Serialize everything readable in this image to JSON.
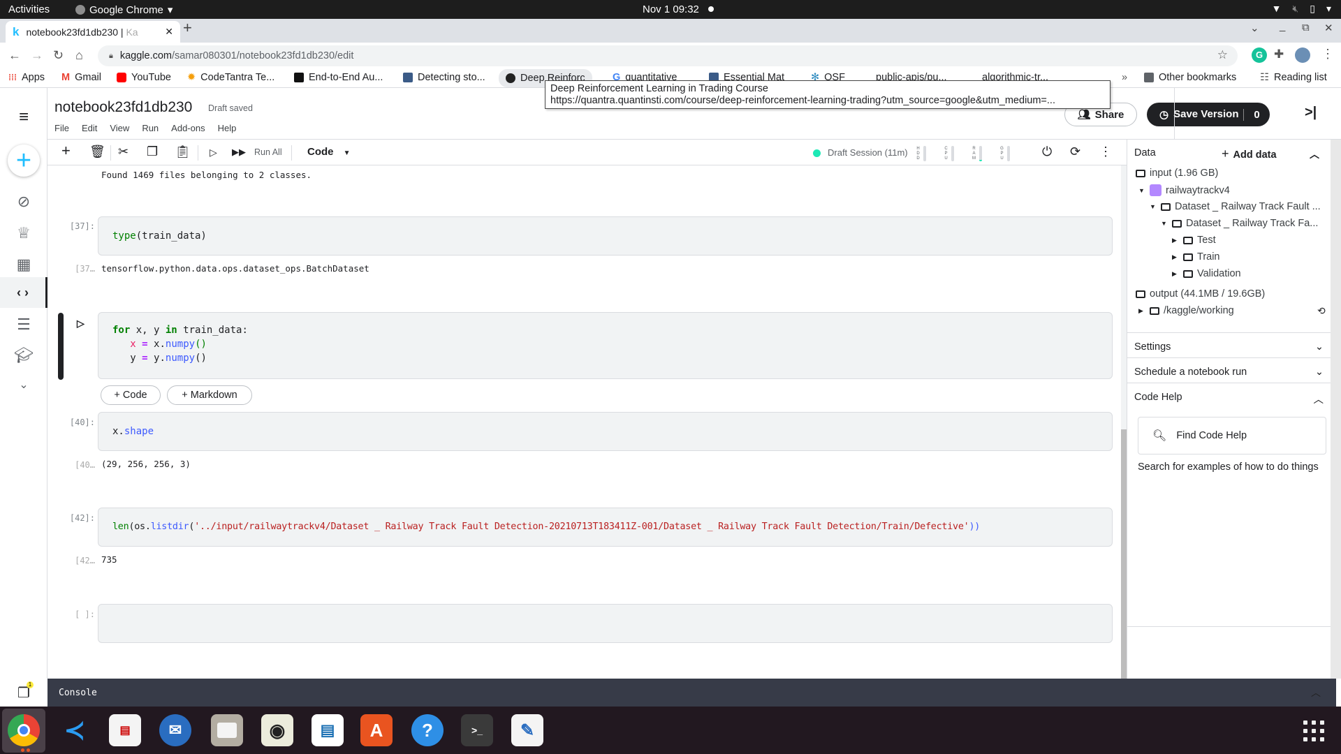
{
  "system": {
    "activities": "Activities",
    "app_name": "Google Chrome",
    "clock": "Nov 1  09:32",
    "status_icons": [
      "wifi-icon",
      "volume-muted-icon",
      "battery-icon",
      "system-menu-icon"
    ]
  },
  "browser": {
    "tab_title": "notebook23fd1db230 | ",
    "tab_title_faded": "Ka",
    "url_host": "kaggle.com",
    "url_path": "/samar080301/notebook23fd1db230/edit",
    "bookmarks": [
      {
        "label": "Apps",
        "color": "#ea4335"
      },
      {
        "label": "Gmail",
        "color": "#ea4335"
      },
      {
        "label": "YouTube",
        "color": "#ff0000"
      },
      {
        "label": "CodeTantra Te...",
        "color": "#f59e0b"
      },
      {
        "label": "End-to-End Au...",
        "color": "#111111"
      },
      {
        "label": "Detecting sto...",
        "color": "#3b5b87"
      },
      {
        "label": "Deep Reinforc",
        "color": "#222222"
      },
      {
        "label": "quantitative",
        "color": "#4285f4"
      },
      {
        "label": "Essential Mat",
        "color": "#3b5b87"
      },
      {
        "label": "OSF",
        "color": "#2e8bc0"
      },
      {
        "label": "public-apis/pu...",
        "color": "#ffffff"
      },
      {
        "label": "algorithmic-tr...",
        "color": "#ffffff"
      }
    ],
    "overflow": "»",
    "other_bookmarks": "Other bookmarks",
    "reading_list": "Reading list",
    "tooltip": {
      "title": "Deep Reinforcement Learning in Trading Course",
      "url": "https://quantra.quantinsti.com/course/deep-reinforcement-learning-trading?utm_source=google&utm_medium=..."
    }
  },
  "kaggle": {
    "notebook_title": "notebook23fd1db230",
    "save_status": "Draft saved",
    "menu": [
      "File",
      "Edit",
      "View",
      "Run",
      "Add-ons",
      "Help"
    ],
    "share_label": "Share",
    "save_version_label": "Save Version",
    "save_version_count": "0",
    "toolbar": {
      "run_all": "Run All",
      "cell_type": "Code",
      "session": "Draft Session (11m)",
      "meters": [
        {
          "label": "HDD",
          "fill": 0.0
        },
        {
          "label": "CPU",
          "fill": 0.0
        },
        {
          "label": "RAM",
          "fill": 0.1
        },
        {
          "label": "GPU",
          "fill": 0.0
        }
      ]
    },
    "cells": {
      "prev_output": "Found 1469 files belonging to 2 classes.",
      "c37_prompt": "[37]:",
      "c37_code_fn": "type",
      "c37_code_rest": "(train_data)",
      "c37_out_prompt": "[37…",
      "c37_output": "tensorflow.python.data.ops.dataset_ops.BatchDataset",
      "active_line1_kw": "for",
      "active_line1_mid": " x, y ",
      "active_line1_kw2": "in",
      "active_line1_end": " train_data:",
      "active_line2_var": "x",
      "active_line2_eq": "=",
      "active_line2_obj": "x.",
      "active_line2_attr": "numpy",
      "active_line2_par": "()",
      "active_line3_var": "y",
      "active_line3_eq": "=",
      "active_line3_obj": "y.",
      "active_line3_attr": "numpy",
      "active_line3_par": "()",
      "add_code": "+ Code",
      "add_markdown": "+ Markdown",
      "c40_prompt": "[40]:",
      "c40_code_obj": "x.",
      "c40_code_attr": "shape",
      "c40_out_prompt": "[40…",
      "c40_output": "(29, 256, 256, 3)",
      "c42_prompt": "[42]:",
      "c42_code_fn": "len",
      "c42_code_open": "(os.",
      "c42_code_attr": "listdir",
      "c42_code_paren": "(",
      "c42_code_str": "'../input/railwaytrackv4/Dataset _ Railway Track Fault Detection-20210713T183411Z-001/Dataset _ Railway Track Fault Detection/Train/Defective'",
      "c42_code_close": "))",
      "c42_out_prompt": "[42…",
      "c42_output": "735",
      "empty_prompt": "[ ]:"
    },
    "data_panel": {
      "title": "Data",
      "add_data": "Add data",
      "input_label": "input (1.96 GB)",
      "dataset": "railwaytrackv4",
      "folder1": "Dataset _ Railway Track Fault ...",
      "folder2": "Dataset _ Railway Track Fa...",
      "subfolders": [
        "Test",
        "Train",
        "Validation"
      ],
      "output_label": "output (44.1MB / 19.6GB)",
      "working": "/kaggle/working",
      "sections": [
        "Settings",
        "Schedule a notebook run",
        "Code Help"
      ],
      "find_code_help": "Find Code Help",
      "code_help_hint": "Search for examples of how to do things"
    },
    "console_label": "Console",
    "notification_count": "1"
  },
  "dock": [
    "Chrome",
    "VS Code",
    "Document Viewer",
    "Thunderbird",
    "Files",
    "Rhythmbox",
    "LibreOffice Writer",
    "Software",
    "Help",
    "Terminal",
    "Text Editor"
  ]
}
